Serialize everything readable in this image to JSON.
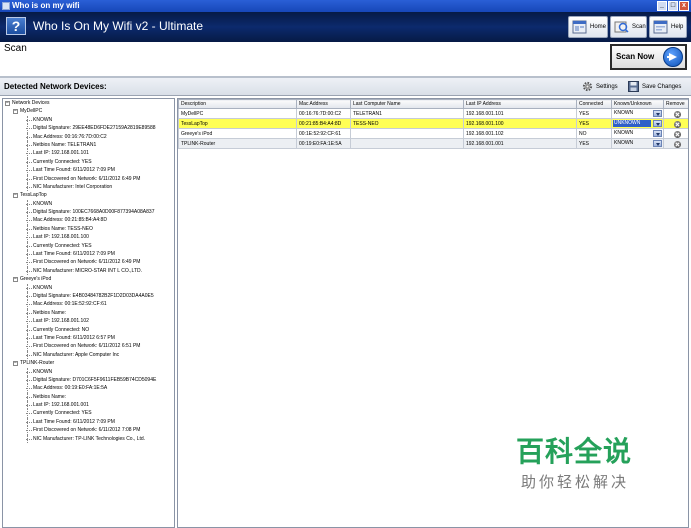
{
  "window": {
    "title": "Who is on my wifi",
    "controls": [
      "_",
      "□",
      "x"
    ]
  },
  "header": {
    "app_icon_glyph": "?",
    "app_title": "Who Is On My Wifi v2 - Ultimate",
    "nav": [
      {
        "label": "Home",
        "icon": "home-icon"
      },
      {
        "label": "Scan",
        "icon": "scan-icon"
      },
      {
        "label": "Help",
        "icon": "help-icon"
      }
    ]
  },
  "page": {
    "title": "Scan",
    "scan_button": "Scan Now"
  },
  "section": {
    "title": "Detected Network Devices:",
    "settings_label": "Settings",
    "save_label": "Save Changes"
  },
  "tree": {
    "root": "Network Devices",
    "devices": [
      {
        "name": "MyDellPC",
        "details": [
          "KNOWN",
          "Digital Signature: 29EE48ED6FDE27159A2819E89588",
          "Mac Address: 00:16:76:7D:00:C2",
          "Netbios Name: TELETRAN1",
          "Last IP: 192.168.001.101",
          "Currently Connected: YES",
          "Last Time Found: 6/11/2012 7:09 PM",
          "First Discovered on Network: 6/11/2012 6:49 PM",
          "NIC Manufacturer: Intel Corporation"
        ]
      },
      {
        "name": "TessLapTop",
        "details": [
          "KNOWN",
          "Digital Signature: 100EC7668A0D00F877394A08A837",
          "Mac Address: 00:21:85:B4:A4:8D",
          "Netbios Name: TESS-NEO",
          "Last IP: 192.168.001.100",
          "Currently Connected: YES",
          "Last Time Found: 6/11/2012 7:09 PM",
          "First Discovered on Network: 6/11/2012 6:49 PM",
          "NIC Manufacturer: MICRO-STAR INT L CO.,LTD."
        ]
      },
      {
        "name": "Greeye's iPod",
        "details": [
          "KNOWN",
          "Digital Signature: E4B03484782B2F1D2D03DA4A0E5",
          "Mac Address: 00:1E:52:92:CF:61",
          "Netbios Name:",
          "Last IP: 192.168.001.102",
          "Currently Connected: NO",
          "Last Time Found: 6/11/2012 6:57 PM",
          "First Discovered on Network: 6/11/2012 6:51 PM",
          "NIC Manufacturer: Apple Computer Inc"
        ]
      },
      {
        "name": "TPLINK-Router",
        "details": [
          "KNOWN",
          "Digital Signature: D701C6F5F9611FEB59B74CD5094E",
          "Mac Address: 00:19:E0:FA:1E:5A",
          "Netbios Name:",
          "Last IP: 192.168.001.001",
          "Currently Connected: YES",
          "Last Time Found: 6/11/2012 7:09 PM",
          "First Discovered on Network: 6/11/2012 7:08 PM",
          "NIC Manufacturer: TP-LINK Technologies Co., Ltd."
        ]
      }
    ]
  },
  "table": {
    "columns": [
      "Description",
      "Mac Address",
      "Last Computer Name",
      "Last IP Address",
      "Connected",
      "Known/Unknown",
      "Remove"
    ],
    "rows": [
      {
        "description": "MyDellPC",
        "mac": "00:16:76:7D:00:C2",
        "computer": "TELETRAN1",
        "ip": "192.168.001.101",
        "connected": "YES",
        "status": "KNOWN",
        "selected": false
      },
      {
        "description": "TessLapTop",
        "mac": "00:21:85:B4:A4:8D",
        "computer": "TESS-NEO",
        "ip": "192.168.001.100",
        "connected": "YES",
        "status": "UNKNOWN",
        "selected": true
      },
      {
        "description": "Greeye's iPod",
        "mac": "00:1E:52:92:CF:61",
        "computer": "",
        "ip": "192.168.001.102",
        "connected": "NO",
        "status": "KNOWN",
        "selected": false
      },
      {
        "description": "TPLINK-Router",
        "mac": "00:19:E0:FA:1E:5A",
        "computer": "",
        "ip": "192.168.001.001",
        "connected": "YES",
        "status": "KNOWN",
        "selected": false
      }
    ]
  },
  "watermark": {
    "main": "百科全说",
    "sub": "助你轻松解决"
  },
  "colors": {
    "header_bg": "#0c2a6d",
    "selected_row": "#ffff55",
    "unknown_highlight": "#2f5fc8",
    "watermark_green": "#25a15a"
  }
}
